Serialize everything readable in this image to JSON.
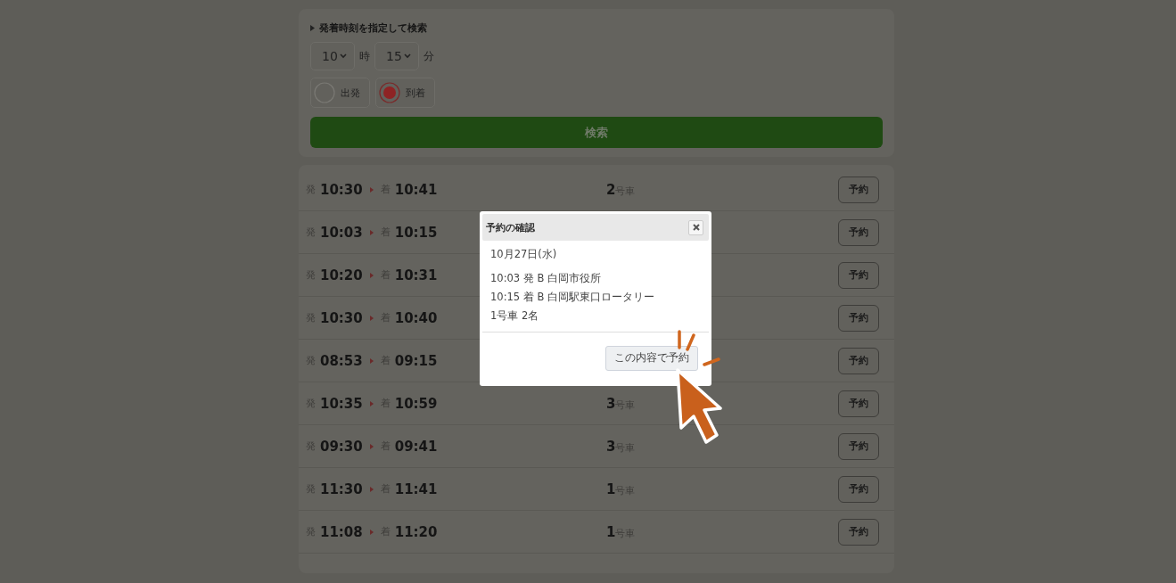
{
  "search": {
    "heading": "発着時刻を指定して検索",
    "hour": "10",
    "hour_unit": "時",
    "minute": "15",
    "minute_unit": "分",
    "modes": [
      {
        "label": "出発",
        "selected": false
      },
      {
        "label": "到着",
        "selected": true
      }
    ],
    "button": "検索"
  },
  "trips": [
    {
      "dep_label": "発",
      "dep": "10:30",
      "arr_label": "着",
      "arr": "10:41",
      "car_number": "2",
      "car_unit": "号車",
      "button": "予約"
    },
    {
      "dep_label": "発",
      "dep": "10:03",
      "arr_label": "着",
      "arr": "10:15",
      "button": "予約"
    },
    {
      "dep_label": "発",
      "dep": "10:20",
      "arr_label": "着",
      "arr": "10:31",
      "button": "予約"
    },
    {
      "dep_label": "発",
      "dep": "10:30",
      "arr_label": "着",
      "arr": "10:40",
      "button": "予約"
    },
    {
      "dep_label": "発",
      "dep": "08:53",
      "arr_label": "着",
      "arr": "09:15",
      "button": "予約"
    },
    {
      "dep_label": "発",
      "dep": "10:35",
      "arr_label": "着",
      "arr": "10:59",
      "car_number": "3",
      "car_unit": "号車",
      "button": "予約"
    },
    {
      "dep_label": "発",
      "dep": "09:30",
      "arr_label": "着",
      "arr": "09:41",
      "car_number": "3",
      "car_unit": "号車",
      "button": "予約"
    },
    {
      "dep_label": "発",
      "dep": "11:30",
      "arr_label": "着",
      "arr": "11:41",
      "car_number": "1",
      "car_unit": "号車",
      "button": "予約"
    },
    {
      "dep_label": "発",
      "dep": "11:08",
      "arr_label": "着",
      "arr": "11:20",
      "car_number": "1",
      "car_unit": "号車",
      "button": "予約"
    }
  ],
  "dialog": {
    "title": "予約の確認",
    "date": "10月27日(水)",
    "lines": [
      "10:03 発 B 白岡市役所",
      "10:15 着 B 白岡駅東口ロータリー",
      "1号車 2名"
    ],
    "confirm_button": "この内容で予約"
  }
}
